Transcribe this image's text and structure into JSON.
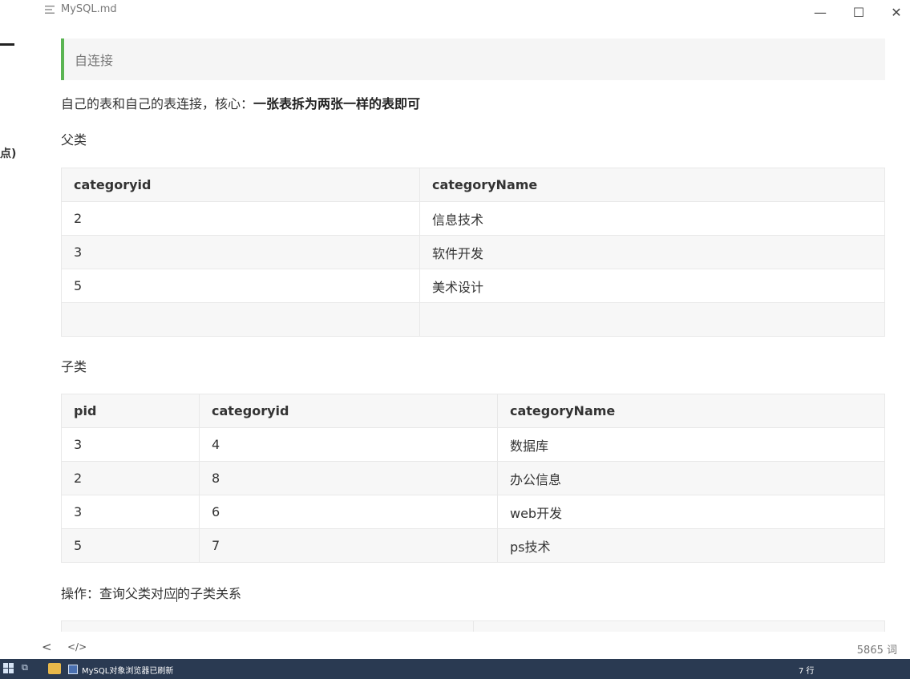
{
  "window": {
    "title": "MySQL.md",
    "minimize_glyph": "—",
    "maximize_glyph": "☐",
    "close_glyph": "✕"
  },
  "sidebar": {
    "fragment_text": "点)"
  },
  "content": {
    "blockquote": "自连接",
    "intro_normal": "自己的表和自己的表连接，核心：",
    "intro_bold": "一张表拆为两张一样的表即可",
    "parent_label": "父类",
    "parent_table": {
      "headers": [
        "categoryid",
        "categoryName"
      ],
      "rows": [
        [
          "2",
          "信息技术"
        ],
        [
          "3",
          "软件开发"
        ],
        [
          "5",
          "美术设计"
        ],
        [
          "",
          ""
        ]
      ]
    },
    "child_label": "子类",
    "child_table": {
      "headers": [
        "pid",
        "categoryid",
        "categoryName"
      ],
      "rows": [
        [
          "3",
          "4",
          "数据库"
        ],
        [
          "2",
          "8",
          "办公信息"
        ],
        [
          "3",
          "6",
          "web开发"
        ],
        [
          "5",
          "7",
          "ps技术"
        ]
      ]
    },
    "operation_text_a": "操作：查询父类对应",
    "operation_text_b": "的子类关系"
  },
  "footer": {
    "back_glyph": "<",
    "source_glyph": "</>",
    "word_count": "5865 词"
  },
  "taskbar": {
    "task_label": "MySQL对象浏览器已刷新",
    "status_text": "7 行"
  },
  "colors": {
    "accent_green": "#5ab452",
    "taskbar_bg": "#2a3a52"
  }
}
